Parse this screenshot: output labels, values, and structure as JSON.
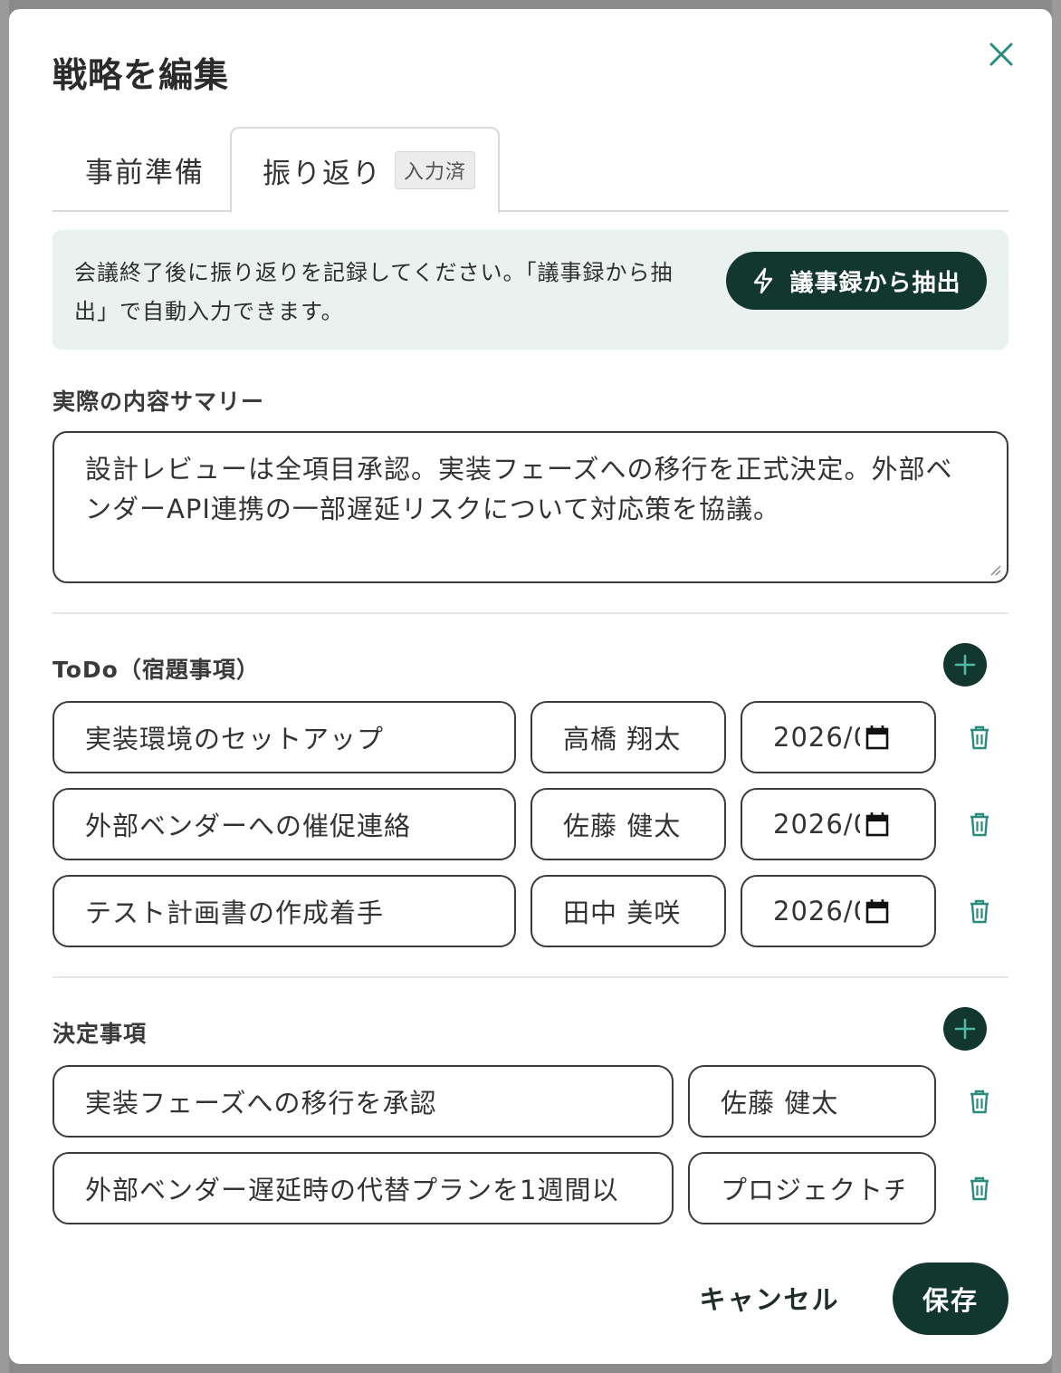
{
  "modal": {
    "title": "戦略を編集"
  },
  "tabs": [
    {
      "label": "事前準備"
    },
    {
      "label": "振り返り",
      "badge": "入力済"
    }
  ],
  "info": {
    "text": "会議終了後に振り返りを記録してください。「議事録から抽出」で自動入力できます。",
    "extract_label": "議事録から抽出"
  },
  "summary": {
    "label": "実際の内容サマリー",
    "value": "設計レビューは全項目承認。実装フェーズへの移行を正式決定。外部ベンダーAPI連携の一部遅延リスクについて対応策を協議。"
  },
  "todo": {
    "label": "ToDo（宿題事項）",
    "items": [
      {
        "task": "実装環境のセットアップ",
        "assignee": "高橋 翔太",
        "date": "2026/0"
      },
      {
        "task": "外部ベンダーへの催促連絡",
        "assignee": "佐藤 健太",
        "date": "2026/0"
      },
      {
        "task": "テスト計画書の作成着手",
        "assignee": "田中 美咲",
        "date": "2026/0"
      }
    ]
  },
  "decisions": {
    "label": "決定事項",
    "items": [
      {
        "text": "実装フェーズへの移行を承認",
        "owner": "佐藤 健太"
      },
      {
        "text": "外部ベンダー遅延時の代替プランを1週間以",
        "owner": "プロジェクトチ"
      }
    ]
  },
  "footer": {
    "cancel_label": "キャンセル",
    "save_label": "保存"
  },
  "colors": {
    "primary": "#12372e",
    "accent_icon": "#2a8c7c",
    "info_bg": "#e9f2ee"
  }
}
